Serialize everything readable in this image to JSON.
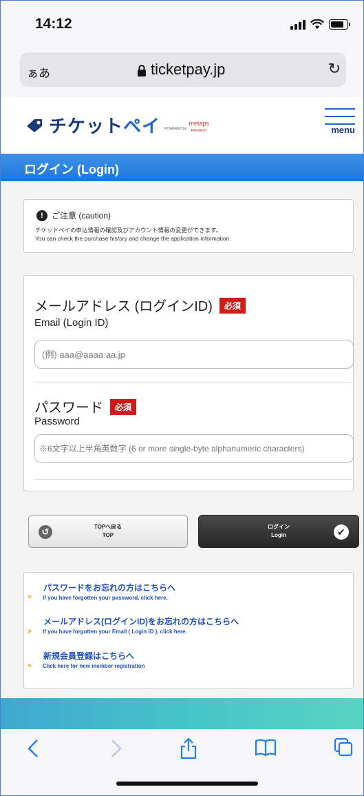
{
  "status": {
    "time": "14:12"
  },
  "browser": {
    "aa_label": "ぁあ",
    "url": "ticketpay.jp"
  },
  "site": {
    "name_a": "チケット",
    "name_b": "ペイ",
    "powered": "POWERED by",
    "metaps_top": "metaps",
    "metaps_bottom": "PAYMENT",
    "menu_label": "menu"
  },
  "title": "ログイン (Login)",
  "caution": {
    "title": "ご注意 (caution)",
    "line1": "チケットペイの申込情報の確認及びアカウント情報の変更ができます。",
    "line2": "You can check the purchase history and change the application information."
  },
  "form": {
    "email": {
      "label": "メールアドレス (ログインID)",
      "required": "必須",
      "sublabel": "Email (Login ID)",
      "placeholder": "(例) aaa@aaaa.aa.jp"
    },
    "password": {
      "label": "パスワード",
      "required": "必須",
      "sublabel": "Password",
      "placeholder": "※6文字以上半角英数字 (6 or more single-byte alphanumeric characters)"
    }
  },
  "buttons": {
    "top_ja": "TOPへ戻る",
    "top_en": "TOP",
    "login_ja": "ログイン",
    "login_en": "Login"
  },
  "links": [
    {
      "ja": "パスワードをお忘れの方はこちらへ",
      "en": "If you have forgotten your password, click here."
    },
    {
      "ja": "メールアドレス(ログインID)をお忘れの方はこちらへ",
      "en": "If you have forgotten your Email ( Login ID ), click here."
    },
    {
      "ja": "新規会員登録はこちらへ",
      "en": "Click here for new member registration"
    }
  ],
  "icons": {
    "back": "chevron-left-icon",
    "forward": "chevron-right-icon",
    "share": "share-icon",
    "bookmarks": "book-icon",
    "tabs": "tabs-icon"
  }
}
